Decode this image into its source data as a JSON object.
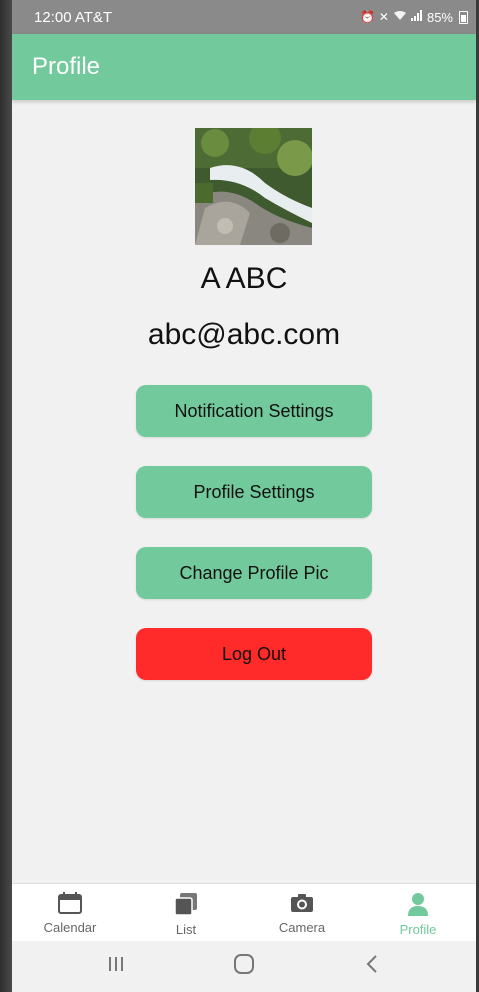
{
  "status_bar": {
    "time_carrier": "12:00 AT&T",
    "battery": "85%"
  },
  "app_bar": {
    "title": "Profile"
  },
  "profile": {
    "name": "A ABC",
    "email": "abc@abc.com"
  },
  "buttons": {
    "notification_settings": "Notification Settings",
    "profile_settings": "Profile Settings",
    "change_profile_pic": "Change Profile Pic",
    "log_out": "Log Out"
  },
  "bottom_nav": {
    "items": [
      {
        "label": "Calendar",
        "icon": "calendar-icon",
        "active": false
      },
      {
        "label": "List",
        "icon": "list-icon",
        "active": false
      },
      {
        "label": "Camera",
        "icon": "camera-icon",
        "active": false
      },
      {
        "label": "Profile",
        "icon": "person-icon",
        "active": true
      }
    ]
  },
  "colors": {
    "accent": "#72c99b",
    "danger": "#ff2a2a",
    "background": "#f1f1f1",
    "status_bar": "#8a8a8a"
  }
}
